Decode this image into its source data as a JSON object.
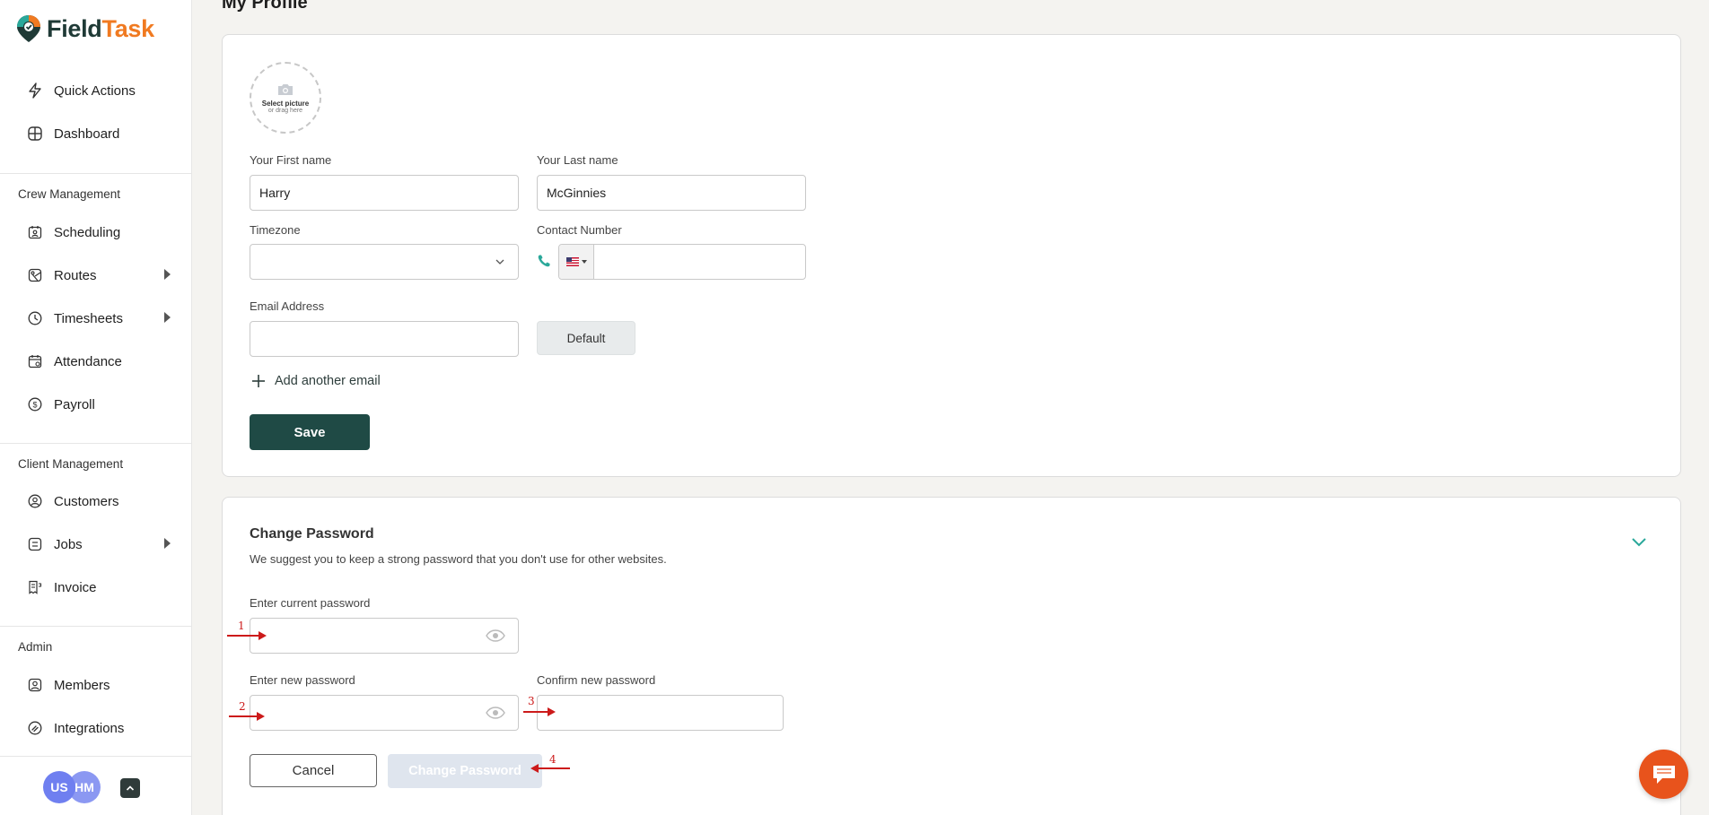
{
  "brand": {
    "part1": "Field",
    "part2": "Task",
    "accent": "#f07a21",
    "dark": "#1f3a36"
  },
  "page_title": "My Profile",
  "sidebar": {
    "top_items": [
      {
        "label": "Quick Actions",
        "icon": "bolt-icon"
      },
      {
        "label": "Dashboard",
        "icon": "grid-icon"
      }
    ],
    "sections": [
      {
        "label": "Crew Management",
        "items": [
          {
            "label": "Scheduling",
            "icon": "calendar-user-icon"
          },
          {
            "label": "Routes",
            "icon": "route-icon",
            "expandable": true
          },
          {
            "label": "Timesheets",
            "icon": "clock-icon",
            "expandable": true
          },
          {
            "label": "Attendance",
            "icon": "calendar-check-icon"
          },
          {
            "label": "Payroll",
            "icon": "dollar-icon"
          }
        ]
      },
      {
        "label": "Client Management",
        "items": [
          {
            "label": "Customers",
            "icon": "user-circle-icon"
          },
          {
            "label": "Jobs",
            "icon": "list-icon",
            "expandable": true
          },
          {
            "label": "Invoice",
            "icon": "invoice-icon"
          }
        ]
      },
      {
        "label": "Admin",
        "items": [
          {
            "label": "Members",
            "icon": "members-icon"
          },
          {
            "label": "Integrations",
            "icon": "integrations-icon"
          }
        ]
      }
    ],
    "avatars": [
      "US",
      "HM"
    ]
  },
  "profile": {
    "picture_line1": "Select picture",
    "picture_line2": "or drag here",
    "first_name_label": "Your First name",
    "first_name_value": "Harry",
    "last_name_label": "Your Last name",
    "last_name_value": "McGinnies",
    "timezone_label": "Timezone",
    "timezone_value": "",
    "contact_label": "Contact Number",
    "contact_value": "",
    "email_label": "Email Address",
    "email_value": "",
    "default_label": "Default",
    "add_email_label": "Add another email",
    "save_label": "Save"
  },
  "password": {
    "title": "Change Password",
    "subtitle": "We suggest you to keep a strong password that you don't use for other websites.",
    "current_label": "Enter current password",
    "new_label": "Enter new password",
    "confirm_label": "Confirm new password",
    "cancel_label": "Cancel",
    "change_label": "Change Password"
  },
  "annotations": [
    "1",
    "2",
    "3",
    "4"
  ],
  "colors": {
    "primary": "#1f4a45",
    "teal": "#2aa89a",
    "annotation": "#cc1a1a",
    "chat": "#e8531c"
  }
}
